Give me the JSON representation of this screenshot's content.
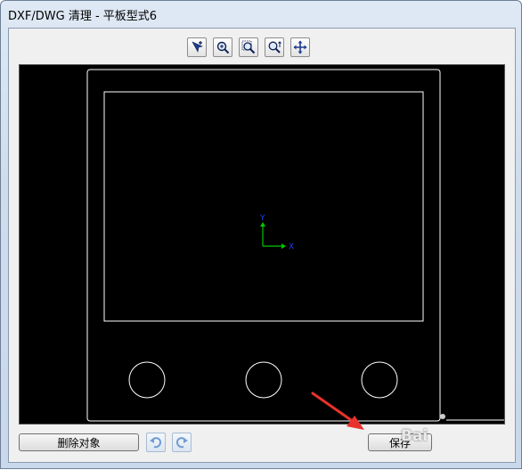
{
  "window": {
    "title": "DXF/DWG 清理 - 平板型式6"
  },
  "toolbar": {
    "tools": [
      {
        "name": "pan-select-icon"
      },
      {
        "name": "zoom-realtime-icon"
      },
      {
        "name": "zoom-window-icon"
      },
      {
        "name": "zoom-extents-icon"
      },
      {
        "name": "move-icon"
      }
    ]
  },
  "canvas": {
    "background": "#000000",
    "line_color": "#ffffff",
    "ucs": {
      "y_label": "Y",
      "x_label": "X",
      "y_color": "#00c800",
      "x_color": "#1e3cff"
    }
  },
  "buttons": {
    "delete_label": "删除对象",
    "save_label": "保存"
  },
  "overlay": {
    "arrow_color": "#e8322b",
    "watermark": "Bai"
  }
}
